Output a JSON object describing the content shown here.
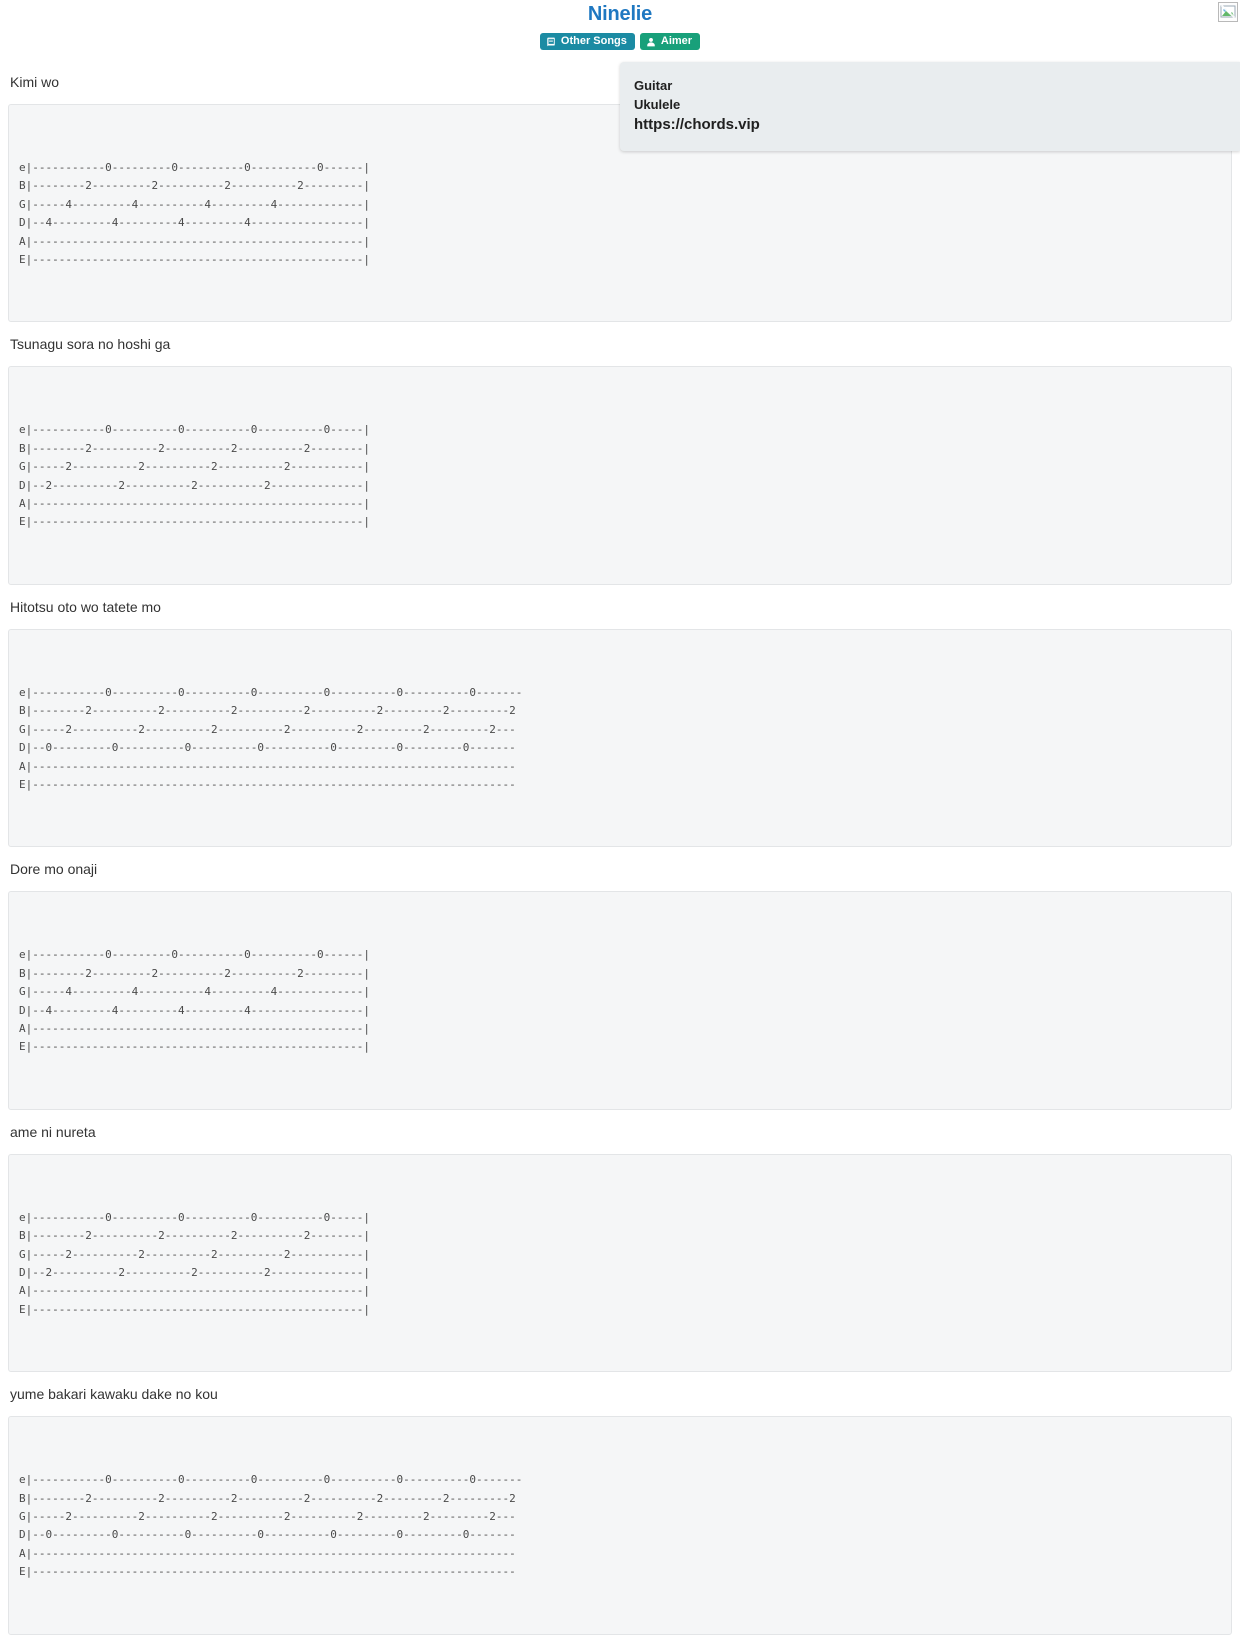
{
  "header": {
    "title": "Ninelie",
    "badges": [
      {
        "label": "Other Songs",
        "icon": "book-icon",
        "color": "#1b8ba3"
      },
      {
        "label": "Aimer",
        "icon": "user-icon",
        "color": "#18a07a"
      }
    ]
  },
  "overlay": {
    "line1": "Guitar",
    "line2": "Ukulele",
    "url": "https://chords.vip"
  },
  "colors": {
    "title": "#1f78c1",
    "tab_background": "#f5f6f7",
    "tab_border": "#e3e5e7",
    "overlay_background": "#e9edef",
    "lyric_text": "#333333",
    "tab_text": "#4a4a4a"
  },
  "sections": [
    {
      "lyric": "Kimi wo",
      "tab": "e|-----------0---------0----------0----------0------|\nB|--------2---------2----------2----------2---------|\nG|-----4---------4----------4---------4-------------|\nD|--4---------4---------4---------4-----------------|\nA|--------------------------------------------------|\nE|--------------------------------------------------|"
    },
    {
      "lyric": "Tsunagu sora no hoshi ga",
      "tab": "e|-----------0----------0----------0----------0-----|\nB|--------2----------2----------2----------2--------|\nG|-----2----------2----------2----------2-----------|\nD|--2----------2----------2----------2--------------|\nA|--------------------------------------------------|\nE|--------------------------------------------------|"
    },
    {
      "lyric": "Hitotsu oto wo tatete mo",
      "tab": "e|-----------0----------0----------0----------0----------0----------0-------\nB|--------2----------2----------2----------2----------2---------2---------2\nG|-----2----------2----------2----------2----------2---------2---------2---\nD|--0---------0----------0----------0----------0---------0---------0-------\nA|-------------------------------------------------------------------------\nE|-------------------------------------------------------------------------"
    },
    {
      "lyric": "Dore mo onaji",
      "tab": "e|-----------0---------0----------0----------0------|\nB|--------2---------2----------2----------2---------|\nG|-----4---------4----------4---------4-------------|\nD|--4---------4---------4---------4-----------------|\nA|--------------------------------------------------|\nE|--------------------------------------------------|"
    },
    {
      "lyric": "ame ni nureta",
      "tab": "e|-----------0----------0----------0----------0-----|\nB|--------2----------2----------2----------2--------|\nG|-----2----------2----------2----------2-----------|\nD|--2----------2----------2----------2--------------|\nA|--------------------------------------------------|\nE|--------------------------------------------------|"
    },
    {
      "lyric": "yume bakari kawaku dake no kou",
      "tab": "e|-----------0----------0----------0----------0----------0----------0-------\nB|--------2----------2----------2----------2----------2---------2---------2\nG|-----2----------2----------2----------2----------2---------2---------2---\nD|--0---------0----------0----------0----------0---------0---------0-------\nA|-------------------------------------------------------------------------\nE|-------------------------------------------------------------------------"
    }
  ]
}
